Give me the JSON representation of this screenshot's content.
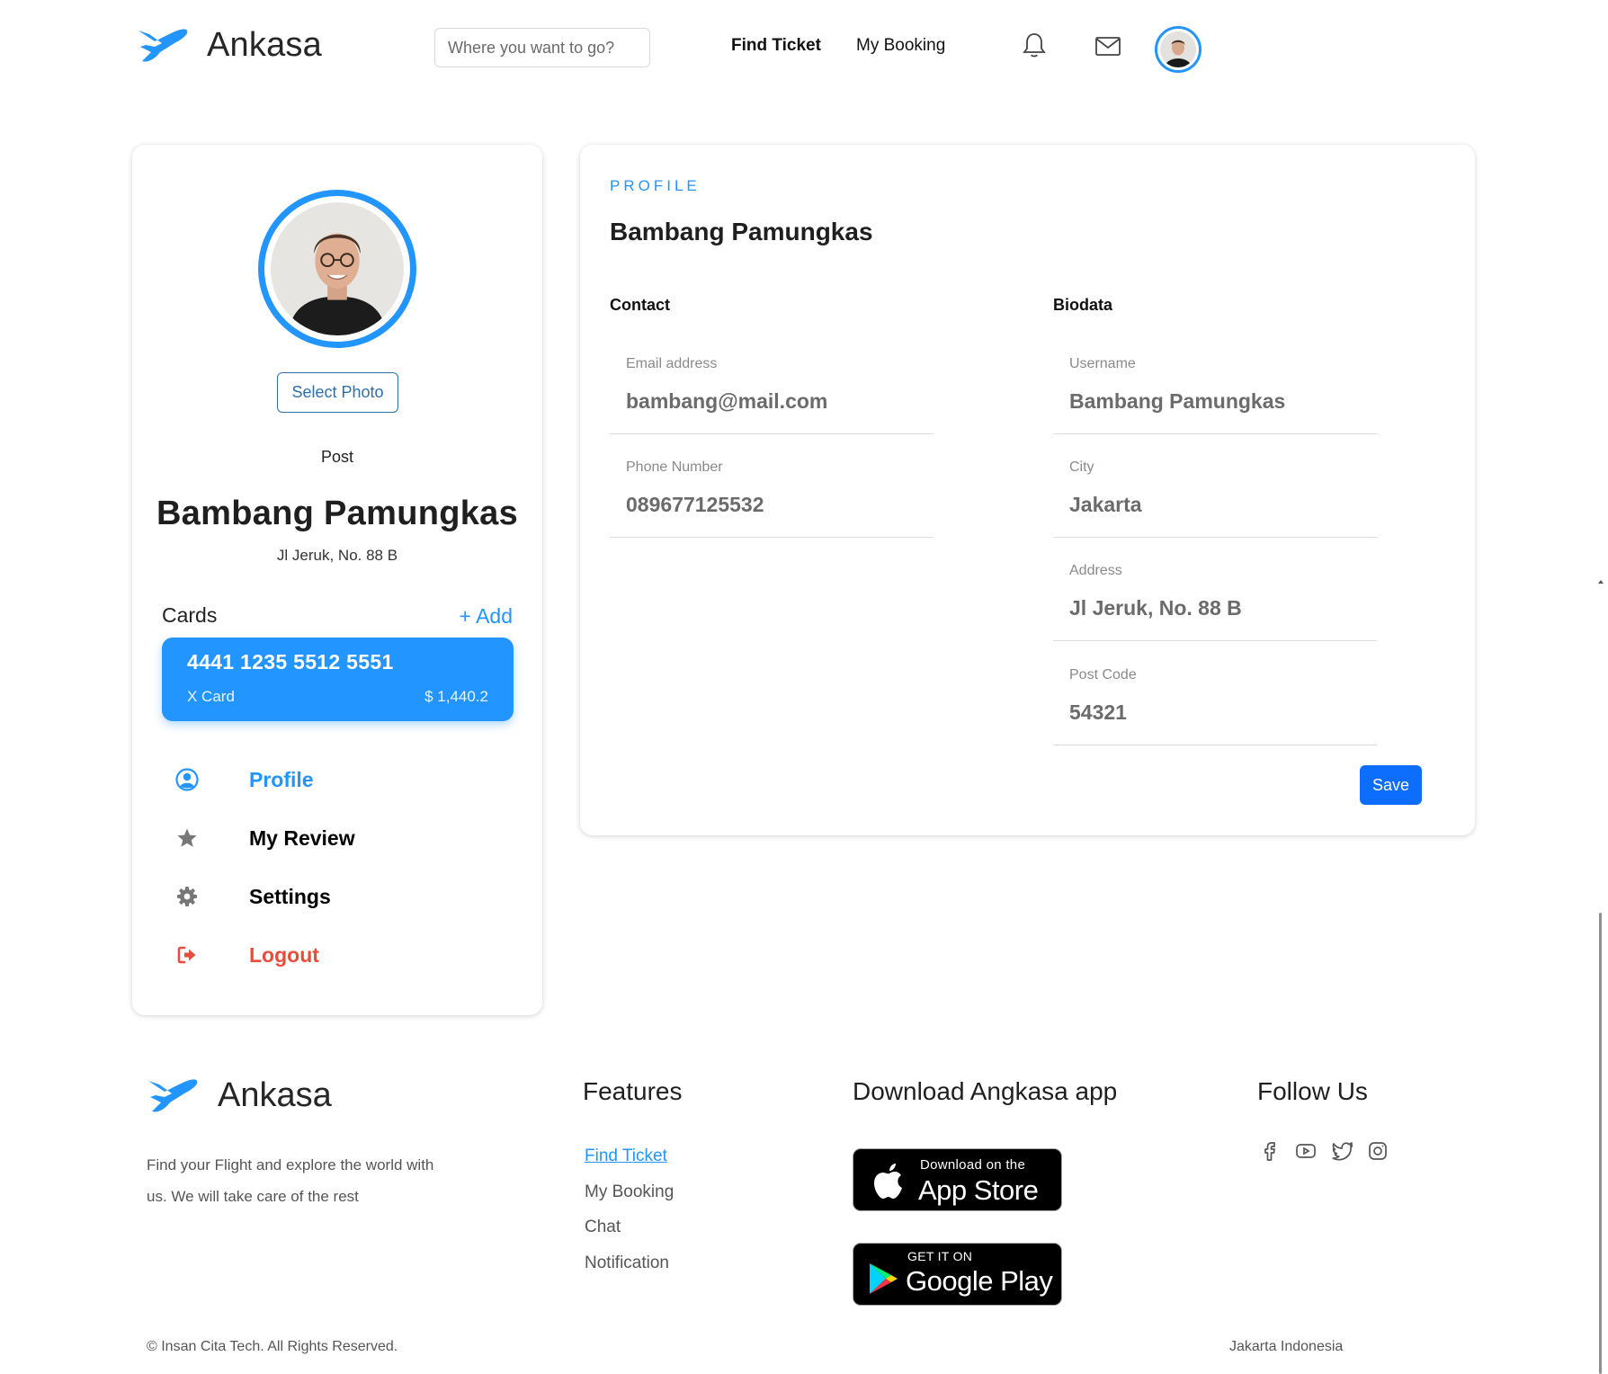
{
  "header": {
    "brand": "Ankasa",
    "search_placeholder": "Where you want to go?",
    "nav": {
      "find_ticket": "Find Ticket",
      "my_booking": "My Booking"
    },
    "icons": [
      "bell-icon",
      "mail-icon"
    ]
  },
  "sidebar": {
    "select_photo": "Select Photo",
    "post": "Post",
    "name": "Bambang Pamungkas",
    "address": "Jl Jeruk, No. 88 B",
    "cards": {
      "title": "Cards",
      "add": "+ Add",
      "card": {
        "number": "4441 1235 5512 5551",
        "type": "X Card",
        "balance": "$ 1,440.2"
      }
    },
    "menu": [
      {
        "label": "Profile",
        "icon": "user-circle-icon",
        "color": "#2395ff"
      },
      {
        "label": "My Review",
        "icon": "star-icon",
        "color": "#000000"
      },
      {
        "label": "Settings",
        "icon": "gear-icon",
        "color": "#000000"
      },
      {
        "label": "Logout",
        "icon": "logout-icon",
        "color": "#e74c3c"
      }
    ]
  },
  "profile": {
    "eyebrow": "PROFILE",
    "name": "Bambang Pamungkas",
    "contact": {
      "title": "Contact",
      "fields": [
        {
          "label": "Email address",
          "value": "bambang@mail.com"
        },
        {
          "label": "Phone Number",
          "value": "089677125532"
        }
      ]
    },
    "biodata": {
      "title": "Biodata",
      "fields": [
        {
          "label": "Username",
          "value": "Bambang Pamungkas"
        },
        {
          "label": "City",
          "value": "Jakarta"
        },
        {
          "label": "Address",
          "value": "Jl Jeruk, No. 88 B"
        },
        {
          "label": "Post Code",
          "value": "54321"
        }
      ]
    },
    "save": "Save"
  },
  "footer": {
    "brand": "Ankasa",
    "description": "Find your Flight and explore the world with us. We will take care of the rest",
    "features": {
      "title": "Features",
      "links": [
        "Find Ticket",
        "My Booking",
        "Chat",
        "Notification"
      ]
    },
    "download": {
      "title": "Download Angkasa app",
      "app_store": {
        "small": "Download on the",
        "big": "App Store"
      },
      "google_play": {
        "small": "GET IT ON",
        "big": "Google Play"
      }
    },
    "follow": {
      "title": "Follow Us",
      "icons": [
        "facebook-icon",
        "youtube-icon",
        "twitter-icon",
        "instagram-icon"
      ]
    },
    "copyright": "© Insan Cita Tech. All Rights Reserved.",
    "location": "Jakarta Indonesia"
  },
  "colors": {
    "accent": "#2395ff",
    "save_button": "#0d6efd",
    "logout": "#e74c3c"
  }
}
